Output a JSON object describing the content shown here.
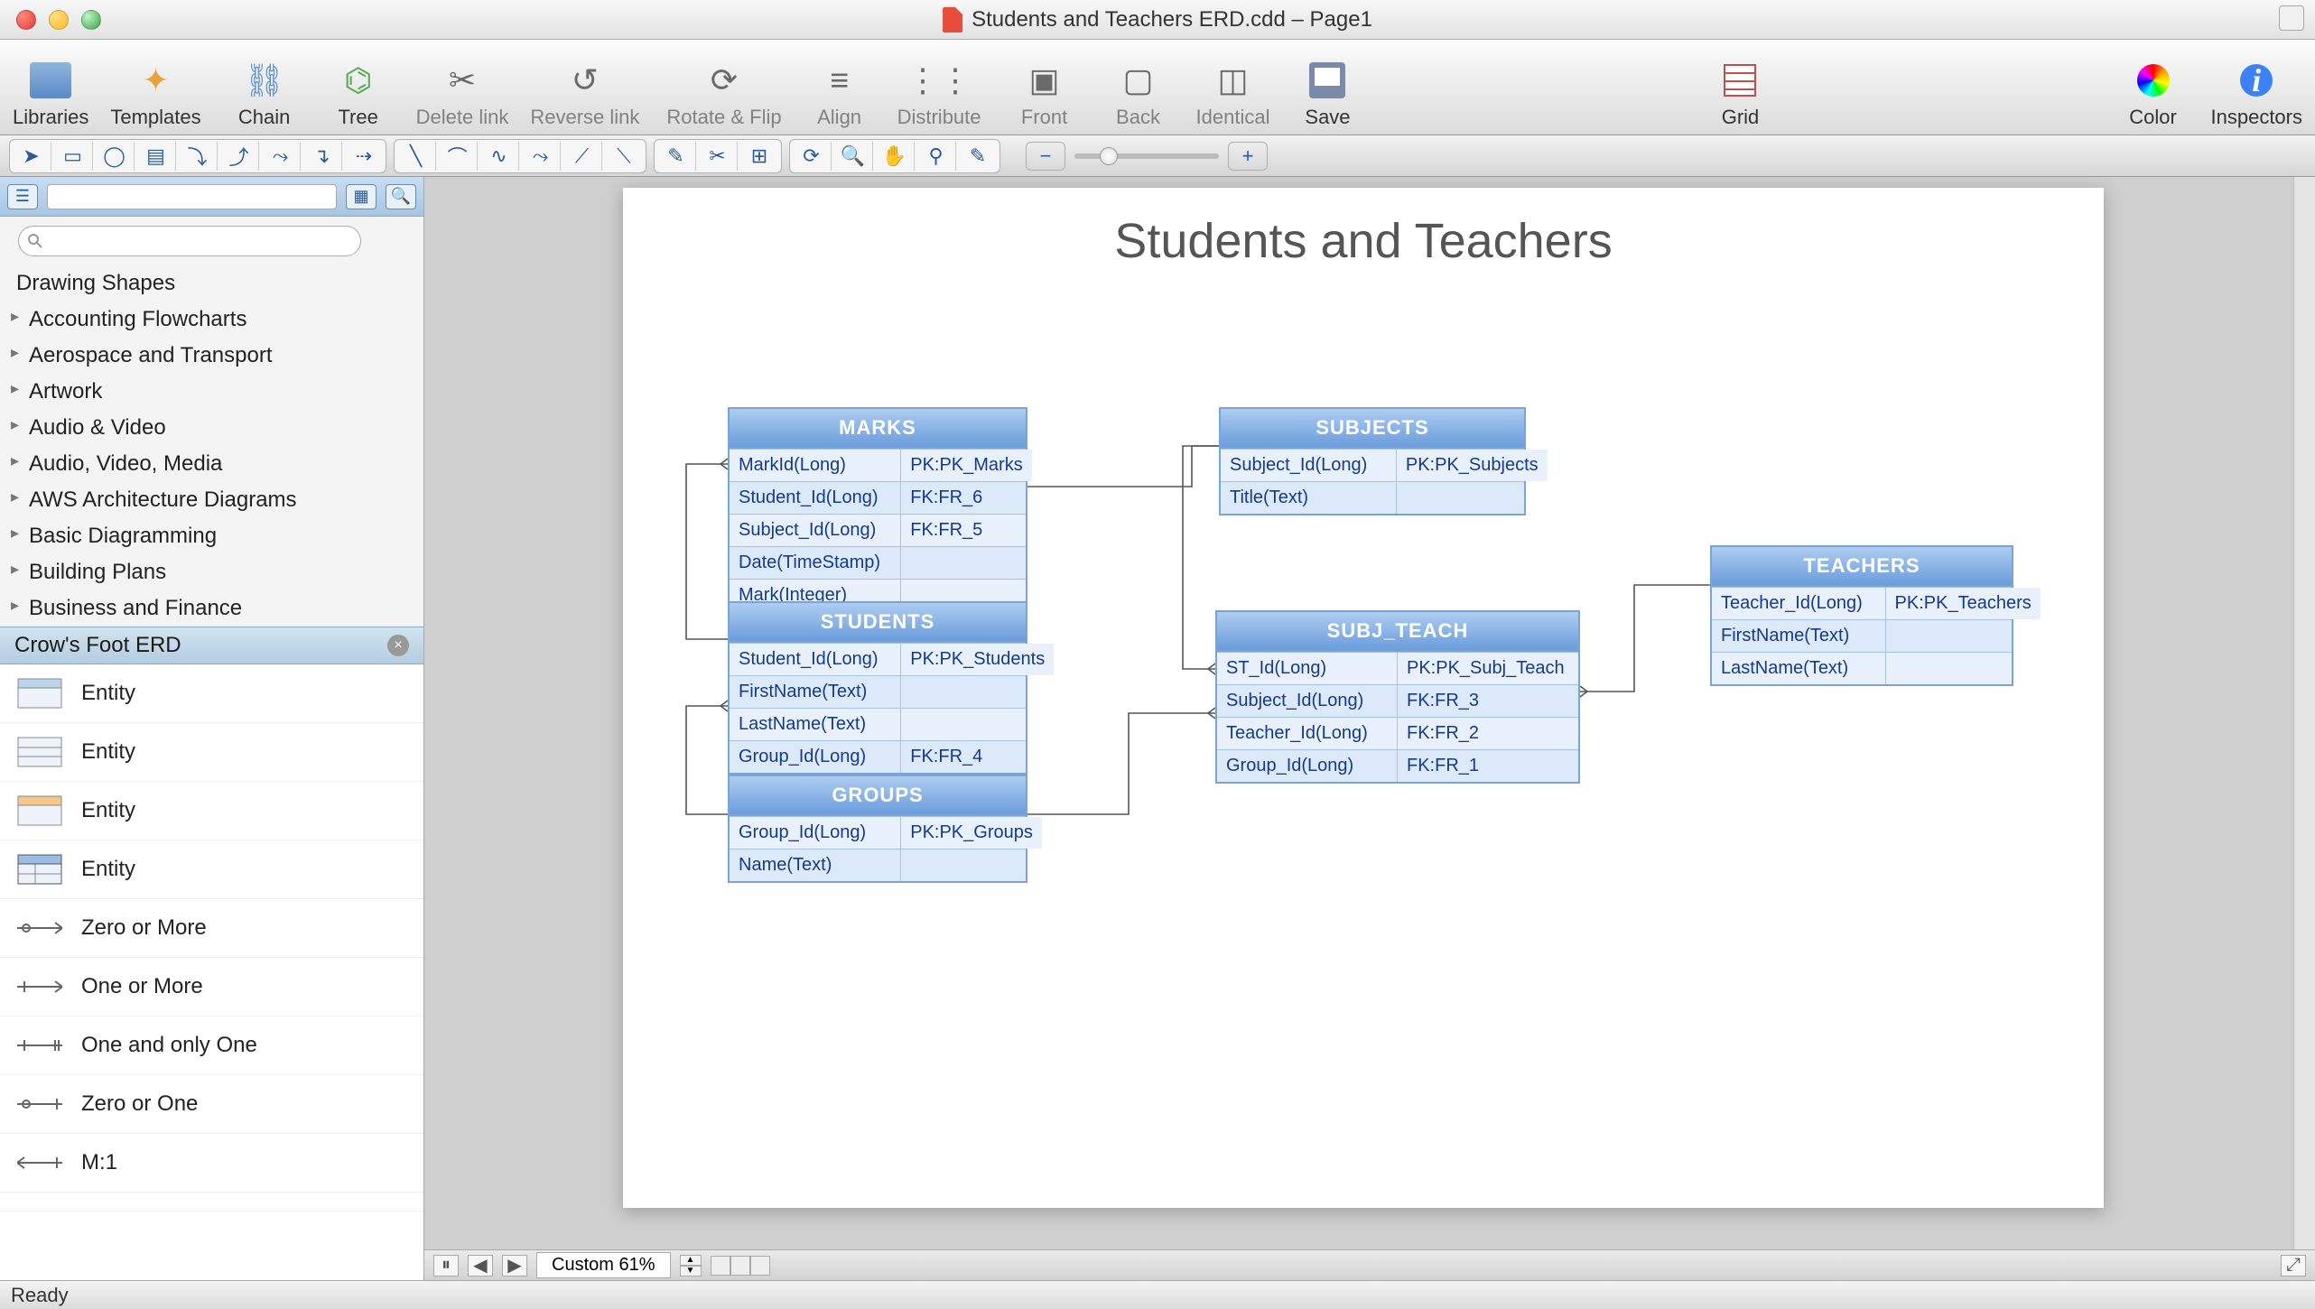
{
  "window": {
    "title": "Students and Teachers ERD.cdd – Page1"
  },
  "toolbar": {
    "libraries": "Libraries",
    "templates": "Templates",
    "chain": "Chain",
    "tree": "Tree",
    "delete_link": "Delete link",
    "reverse_link": "Reverse link",
    "rotate_flip": "Rotate & Flip",
    "align": "Align",
    "distribute": "Distribute",
    "front": "Front",
    "back": "Back",
    "identical": "Identical",
    "save": "Save",
    "grid": "Grid",
    "color": "Color",
    "inspectors": "Inspectors"
  },
  "sidebar": {
    "drawing_shapes": "Drawing Shapes",
    "categories": [
      "Accounting Flowcharts",
      "Aerospace and Transport",
      "Artwork",
      "Audio & Video",
      "Audio, Video, Media",
      "AWS Architecture Diagrams",
      "Basic Diagramming",
      "Building Plans",
      "Business and Finance"
    ],
    "selected_category": "Crow's Foot ERD",
    "shapes": [
      {
        "label": "Entity"
      },
      {
        "label": "Entity"
      },
      {
        "label": "Entity"
      },
      {
        "label": "Entity"
      },
      {
        "label": "Zero or More"
      },
      {
        "label": "One or More"
      },
      {
        "label": "One and only One"
      },
      {
        "label": "Zero or One"
      },
      {
        "label": "M:1"
      }
    ]
  },
  "diagram": {
    "title": "Students and Teachers",
    "entities": {
      "marks": {
        "name": "MARKS",
        "rows": [
          {
            "c1": "MarkId(Long)",
            "c2": "PK:PK_Marks"
          },
          {
            "c1": "Student_Id(Long)",
            "c2": "FK:FR_6"
          },
          {
            "c1": "Subject_Id(Long)",
            "c2": "FK:FR_5"
          },
          {
            "c1": "Date(TimeStamp)",
            "c2": ""
          },
          {
            "c1": "Mark(Integer)",
            "c2": ""
          }
        ]
      },
      "subjects": {
        "name": "SUBJECTS",
        "rows": [
          {
            "c1": "Subject_Id(Long)",
            "c2": "PK:PK_Subjects"
          },
          {
            "c1": "Title(Text)",
            "c2": ""
          }
        ]
      },
      "students": {
        "name": "STUDENTS",
        "rows": [
          {
            "c1": "Student_Id(Long)",
            "c2": "PK:PK_Students"
          },
          {
            "c1": "FirstName(Text)",
            "c2": ""
          },
          {
            "c1": "LastName(Text)",
            "c2": ""
          },
          {
            "c1": "Group_Id(Long)",
            "c2": "FK:FR_4"
          }
        ]
      },
      "subj_teach": {
        "name": "SUBJ_TEACH",
        "rows": [
          {
            "c1": "ST_Id(Long)",
            "c2": "PK:PK_Subj_Teach"
          },
          {
            "c1": "Subject_Id(Long)",
            "c2": "FK:FR_3"
          },
          {
            "c1": "Teacher_Id(Long)",
            "c2": "FK:FR_2"
          },
          {
            "c1": "Group_Id(Long)",
            "c2": "FK:FR_1"
          }
        ]
      },
      "teachers": {
        "name": "TEACHERS",
        "rows": [
          {
            "c1": "Teacher_Id(Long)",
            "c2": "PK:PK_Teachers"
          },
          {
            "c1": "FirstName(Text)",
            "c2": ""
          },
          {
            "c1": "LastName(Text)",
            "c2": ""
          }
        ]
      },
      "groups": {
        "name": "GROUPS",
        "rows": [
          {
            "c1": "Group_Id(Long)",
            "c2": "PK:PK_Groups"
          },
          {
            "c1": "Name(Text)",
            "c2": ""
          }
        ]
      }
    }
  },
  "status": {
    "ready": "Ready",
    "zoom_label": "Custom 61%"
  }
}
